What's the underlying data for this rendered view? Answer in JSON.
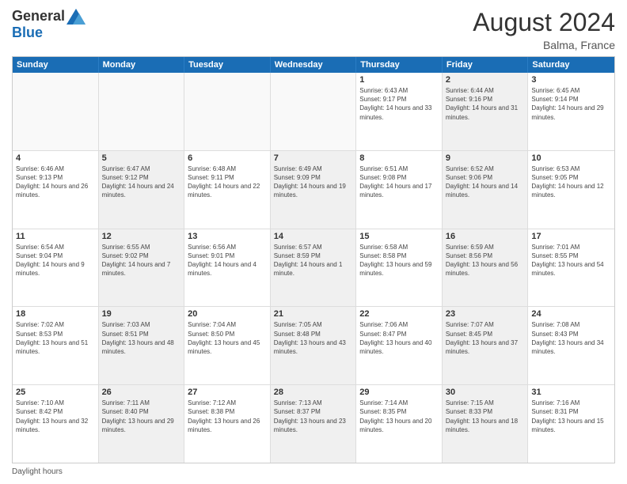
{
  "header": {
    "logo_general": "General",
    "logo_blue": "Blue",
    "month_year": "August 2024",
    "location": "Balma, France"
  },
  "days_of_week": [
    "Sunday",
    "Monday",
    "Tuesday",
    "Wednesday",
    "Thursday",
    "Friday",
    "Saturday"
  ],
  "footer": {
    "daylight_hours": "Daylight hours"
  },
  "weeks": [
    {
      "cells": [
        {
          "empty": true,
          "shaded": false
        },
        {
          "empty": true,
          "shaded": false
        },
        {
          "empty": true,
          "shaded": false
        },
        {
          "empty": true,
          "shaded": false
        },
        {
          "day": 1,
          "sunrise": "Sunrise: 6:43 AM",
          "sunset": "Sunset: 9:17 PM",
          "daylight": "Daylight: 14 hours and 33 minutes.",
          "shaded": false
        },
        {
          "day": 2,
          "sunrise": "Sunrise: 6:44 AM",
          "sunset": "Sunset: 9:16 PM",
          "daylight": "Daylight: 14 hours and 31 minutes.",
          "shaded": true
        },
        {
          "day": 3,
          "sunrise": "Sunrise: 6:45 AM",
          "sunset": "Sunset: 9:14 PM",
          "daylight": "Daylight: 14 hours and 29 minutes.",
          "shaded": false
        }
      ]
    },
    {
      "cells": [
        {
          "day": 4,
          "sunrise": "Sunrise: 6:46 AM",
          "sunset": "Sunset: 9:13 PM",
          "daylight": "Daylight: 14 hours and 26 minutes.",
          "shaded": false
        },
        {
          "day": 5,
          "sunrise": "Sunrise: 6:47 AM",
          "sunset": "Sunset: 9:12 PM",
          "daylight": "Daylight: 14 hours and 24 minutes.",
          "shaded": true
        },
        {
          "day": 6,
          "sunrise": "Sunrise: 6:48 AM",
          "sunset": "Sunset: 9:11 PM",
          "daylight": "Daylight: 14 hours and 22 minutes.",
          "shaded": false
        },
        {
          "day": 7,
          "sunrise": "Sunrise: 6:49 AM",
          "sunset": "Sunset: 9:09 PM",
          "daylight": "Daylight: 14 hours and 19 minutes.",
          "shaded": true
        },
        {
          "day": 8,
          "sunrise": "Sunrise: 6:51 AM",
          "sunset": "Sunset: 9:08 PM",
          "daylight": "Daylight: 14 hours and 17 minutes.",
          "shaded": false
        },
        {
          "day": 9,
          "sunrise": "Sunrise: 6:52 AM",
          "sunset": "Sunset: 9:06 PM",
          "daylight": "Daylight: 14 hours and 14 minutes.",
          "shaded": true
        },
        {
          "day": 10,
          "sunrise": "Sunrise: 6:53 AM",
          "sunset": "Sunset: 9:05 PM",
          "daylight": "Daylight: 14 hours and 12 minutes.",
          "shaded": false
        }
      ]
    },
    {
      "cells": [
        {
          "day": 11,
          "sunrise": "Sunrise: 6:54 AM",
          "sunset": "Sunset: 9:04 PM",
          "daylight": "Daylight: 14 hours and 9 minutes.",
          "shaded": false
        },
        {
          "day": 12,
          "sunrise": "Sunrise: 6:55 AM",
          "sunset": "Sunset: 9:02 PM",
          "daylight": "Daylight: 14 hours and 7 minutes.",
          "shaded": true
        },
        {
          "day": 13,
          "sunrise": "Sunrise: 6:56 AM",
          "sunset": "Sunset: 9:01 PM",
          "daylight": "Daylight: 14 hours and 4 minutes.",
          "shaded": false
        },
        {
          "day": 14,
          "sunrise": "Sunrise: 6:57 AM",
          "sunset": "Sunset: 8:59 PM",
          "daylight": "Daylight: 14 hours and 1 minute.",
          "shaded": true
        },
        {
          "day": 15,
          "sunrise": "Sunrise: 6:58 AM",
          "sunset": "Sunset: 8:58 PM",
          "daylight": "Daylight: 13 hours and 59 minutes.",
          "shaded": false
        },
        {
          "day": 16,
          "sunrise": "Sunrise: 6:59 AM",
          "sunset": "Sunset: 8:56 PM",
          "daylight": "Daylight: 13 hours and 56 minutes.",
          "shaded": true
        },
        {
          "day": 17,
          "sunrise": "Sunrise: 7:01 AM",
          "sunset": "Sunset: 8:55 PM",
          "daylight": "Daylight: 13 hours and 54 minutes.",
          "shaded": false
        }
      ]
    },
    {
      "cells": [
        {
          "day": 18,
          "sunrise": "Sunrise: 7:02 AM",
          "sunset": "Sunset: 8:53 PM",
          "daylight": "Daylight: 13 hours and 51 minutes.",
          "shaded": false
        },
        {
          "day": 19,
          "sunrise": "Sunrise: 7:03 AM",
          "sunset": "Sunset: 8:51 PM",
          "daylight": "Daylight: 13 hours and 48 minutes.",
          "shaded": true
        },
        {
          "day": 20,
          "sunrise": "Sunrise: 7:04 AM",
          "sunset": "Sunset: 8:50 PM",
          "daylight": "Daylight: 13 hours and 45 minutes.",
          "shaded": false
        },
        {
          "day": 21,
          "sunrise": "Sunrise: 7:05 AM",
          "sunset": "Sunset: 8:48 PM",
          "daylight": "Daylight: 13 hours and 43 minutes.",
          "shaded": true
        },
        {
          "day": 22,
          "sunrise": "Sunrise: 7:06 AM",
          "sunset": "Sunset: 8:47 PM",
          "daylight": "Daylight: 13 hours and 40 minutes.",
          "shaded": false
        },
        {
          "day": 23,
          "sunrise": "Sunrise: 7:07 AM",
          "sunset": "Sunset: 8:45 PM",
          "daylight": "Daylight: 13 hours and 37 minutes.",
          "shaded": true
        },
        {
          "day": 24,
          "sunrise": "Sunrise: 7:08 AM",
          "sunset": "Sunset: 8:43 PM",
          "daylight": "Daylight: 13 hours and 34 minutes.",
          "shaded": false
        }
      ]
    },
    {
      "cells": [
        {
          "day": 25,
          "sunrise": "Sunrise: 7:10 AM",
          "sunset": "Sunset: 8:42 PM",
          "daylight": "Daylight: 13 hours and 32 minutes.",
          "shaded": false
        },
        {
          "day": 26,
          "sunrise": "Sunrise: 7:11 AM",
          "sunset": "Sunset: 8:40 PM",
          "daylight": "Daylight: 13 hours and 29 minutes.",
          "shaded": true
        },
        {
          "day": 27,
          "sunrise": "Sunrise: 7:12 AM",
          "sunset": "Sunset: 8:38 PM",
          "daylight": "Daylight: 13 hours and 26 minutes.",
          "shaded": false
        },
        {
          "day": 28,
          "sunrise": "Sunrise: 7:13 AM",
          "sunset": "Sunset: 8:37 PM",
          "daylight": "Daylight: 13 hours and 23 minutes.",
          "shaded": true
        },
        {
          "day": 29,
          "sunrise": "Sunrise: 7:14 AM",
          "sunset": "Sunset: 8:35 PM",
          "daylight": "Daylight: 13 hours and 20 minutes.",
          "shaded": false
        },
        {
          "day": 30,
          "sunrise": "Sunrise: 7:15 AM",
          "sunset": "Sunset: 8:33 PM",
          "daylight": "Daylight: 13 hours and 18 minutes.",
          "shaded": true
        },
        {
          "day": 31,
          "sunrise": "Sunrise: 7:16 AM",
          "sunset": "Sunset: 8:31 PM",
          "daylight": "Daylight: 13 hours and 15 minutes.",
          "shaded": false
        }
      ]
    }
  ]
}
